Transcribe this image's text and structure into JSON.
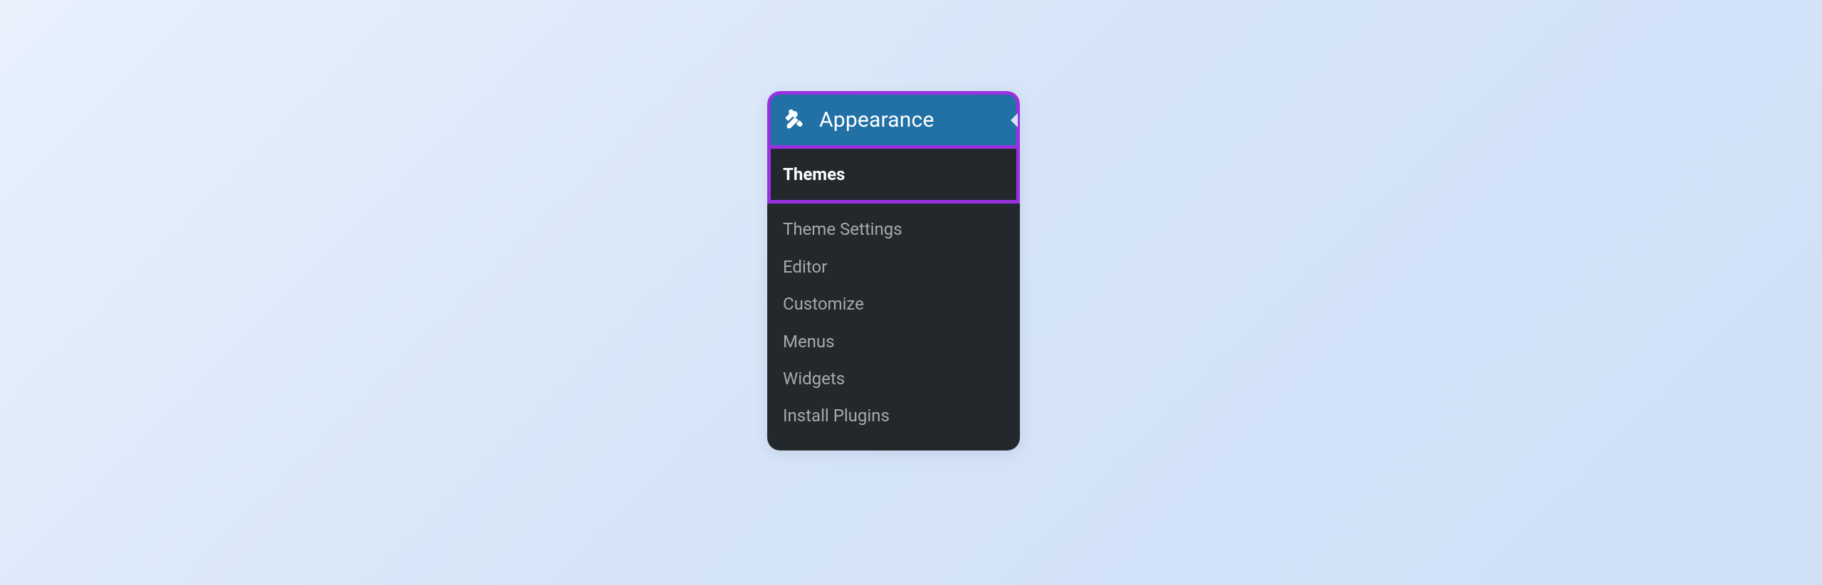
{
  "menu": {
    "header": {
      "icon_name": "appearance-brush-icon",
      "label": "Appearance"
    },
    "items": [
      {
        "label": "Themes",
        "active": true
      },
      {
        "label": "Theme Settings",
        "active": false
      },
      {
        "label": "Editor",
        "active": false
      },
      {
        "label": "Customize",
        "active": false
      },
      {
        "label": "Menus",
        "active": false
      },
      {
        "label": "Widgets",
        "active": false
      },
      {
        "label": "Install Plugins",
        "active": false
      }
    ]
  },
  "colors": {
    "highlight_border": "#9a31e0",
    "header_bg": "#2171a6",
    "submenu_bg": "#23282d"
  }
}
